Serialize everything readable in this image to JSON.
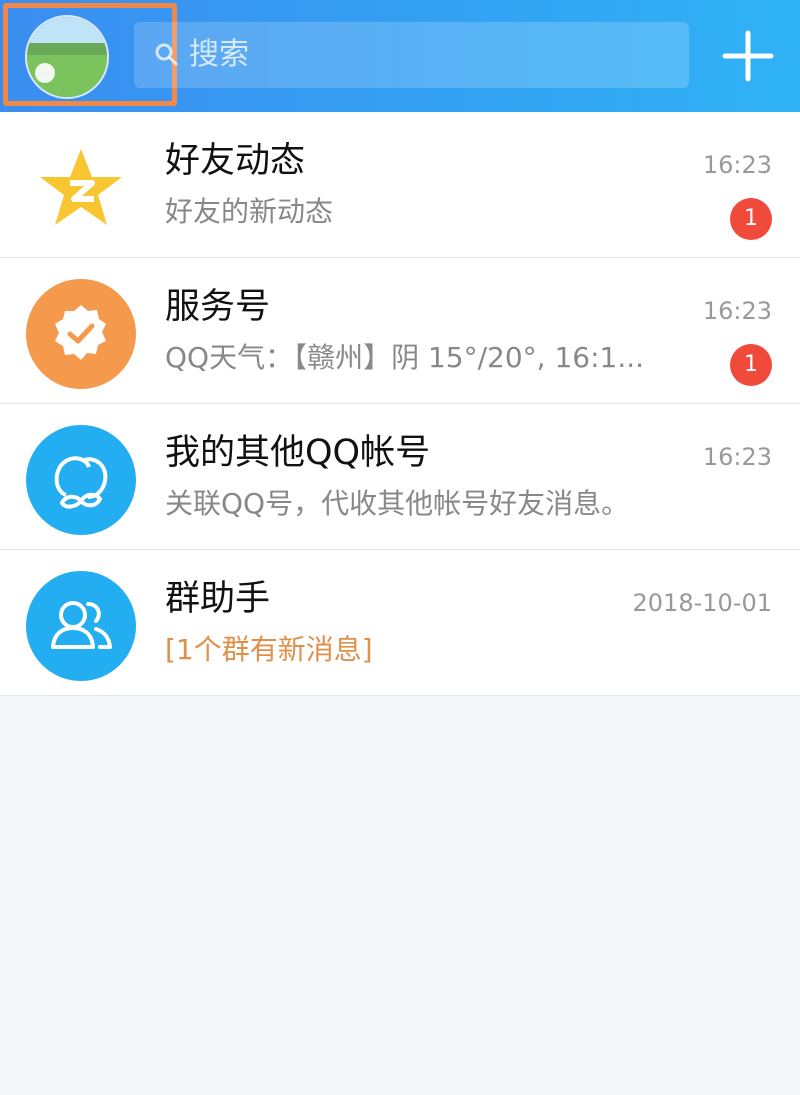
{
  "header": {
    "search_placeholder": "搜索",
    "accent_color": "#2fa4f3",
    "highlight_frame_color": "#f0884a"
  },
  "list": [
    {
      "title": "好友动态",
      "subtitle": "好友的新动态",
      "time": "16:23",
      "badge": "1",
      "icon": "qzone-star-icon"
    },
    {
      "title": "服务号",
      "subtitle": "QQ天气：【赣州】阴 15°/20°, 16:1...",
      "time": "16:23",
      "badge": "1",
      "icon": "service-account-icon"
    },
    {
      "title": "我的其他QQ帐号",
      "subtitle": "关联QQ号，代收其他帐号好友消息。",
      "time": "16:23",
      "icon": "linked-accounts-icon"
    },
    {
      "title": "群助手",
      "subtitle": "[1个群有新消息]",
      "time": "2018-10-01",
      "icon": "group-assistant-icon"
    }
  ]
}
